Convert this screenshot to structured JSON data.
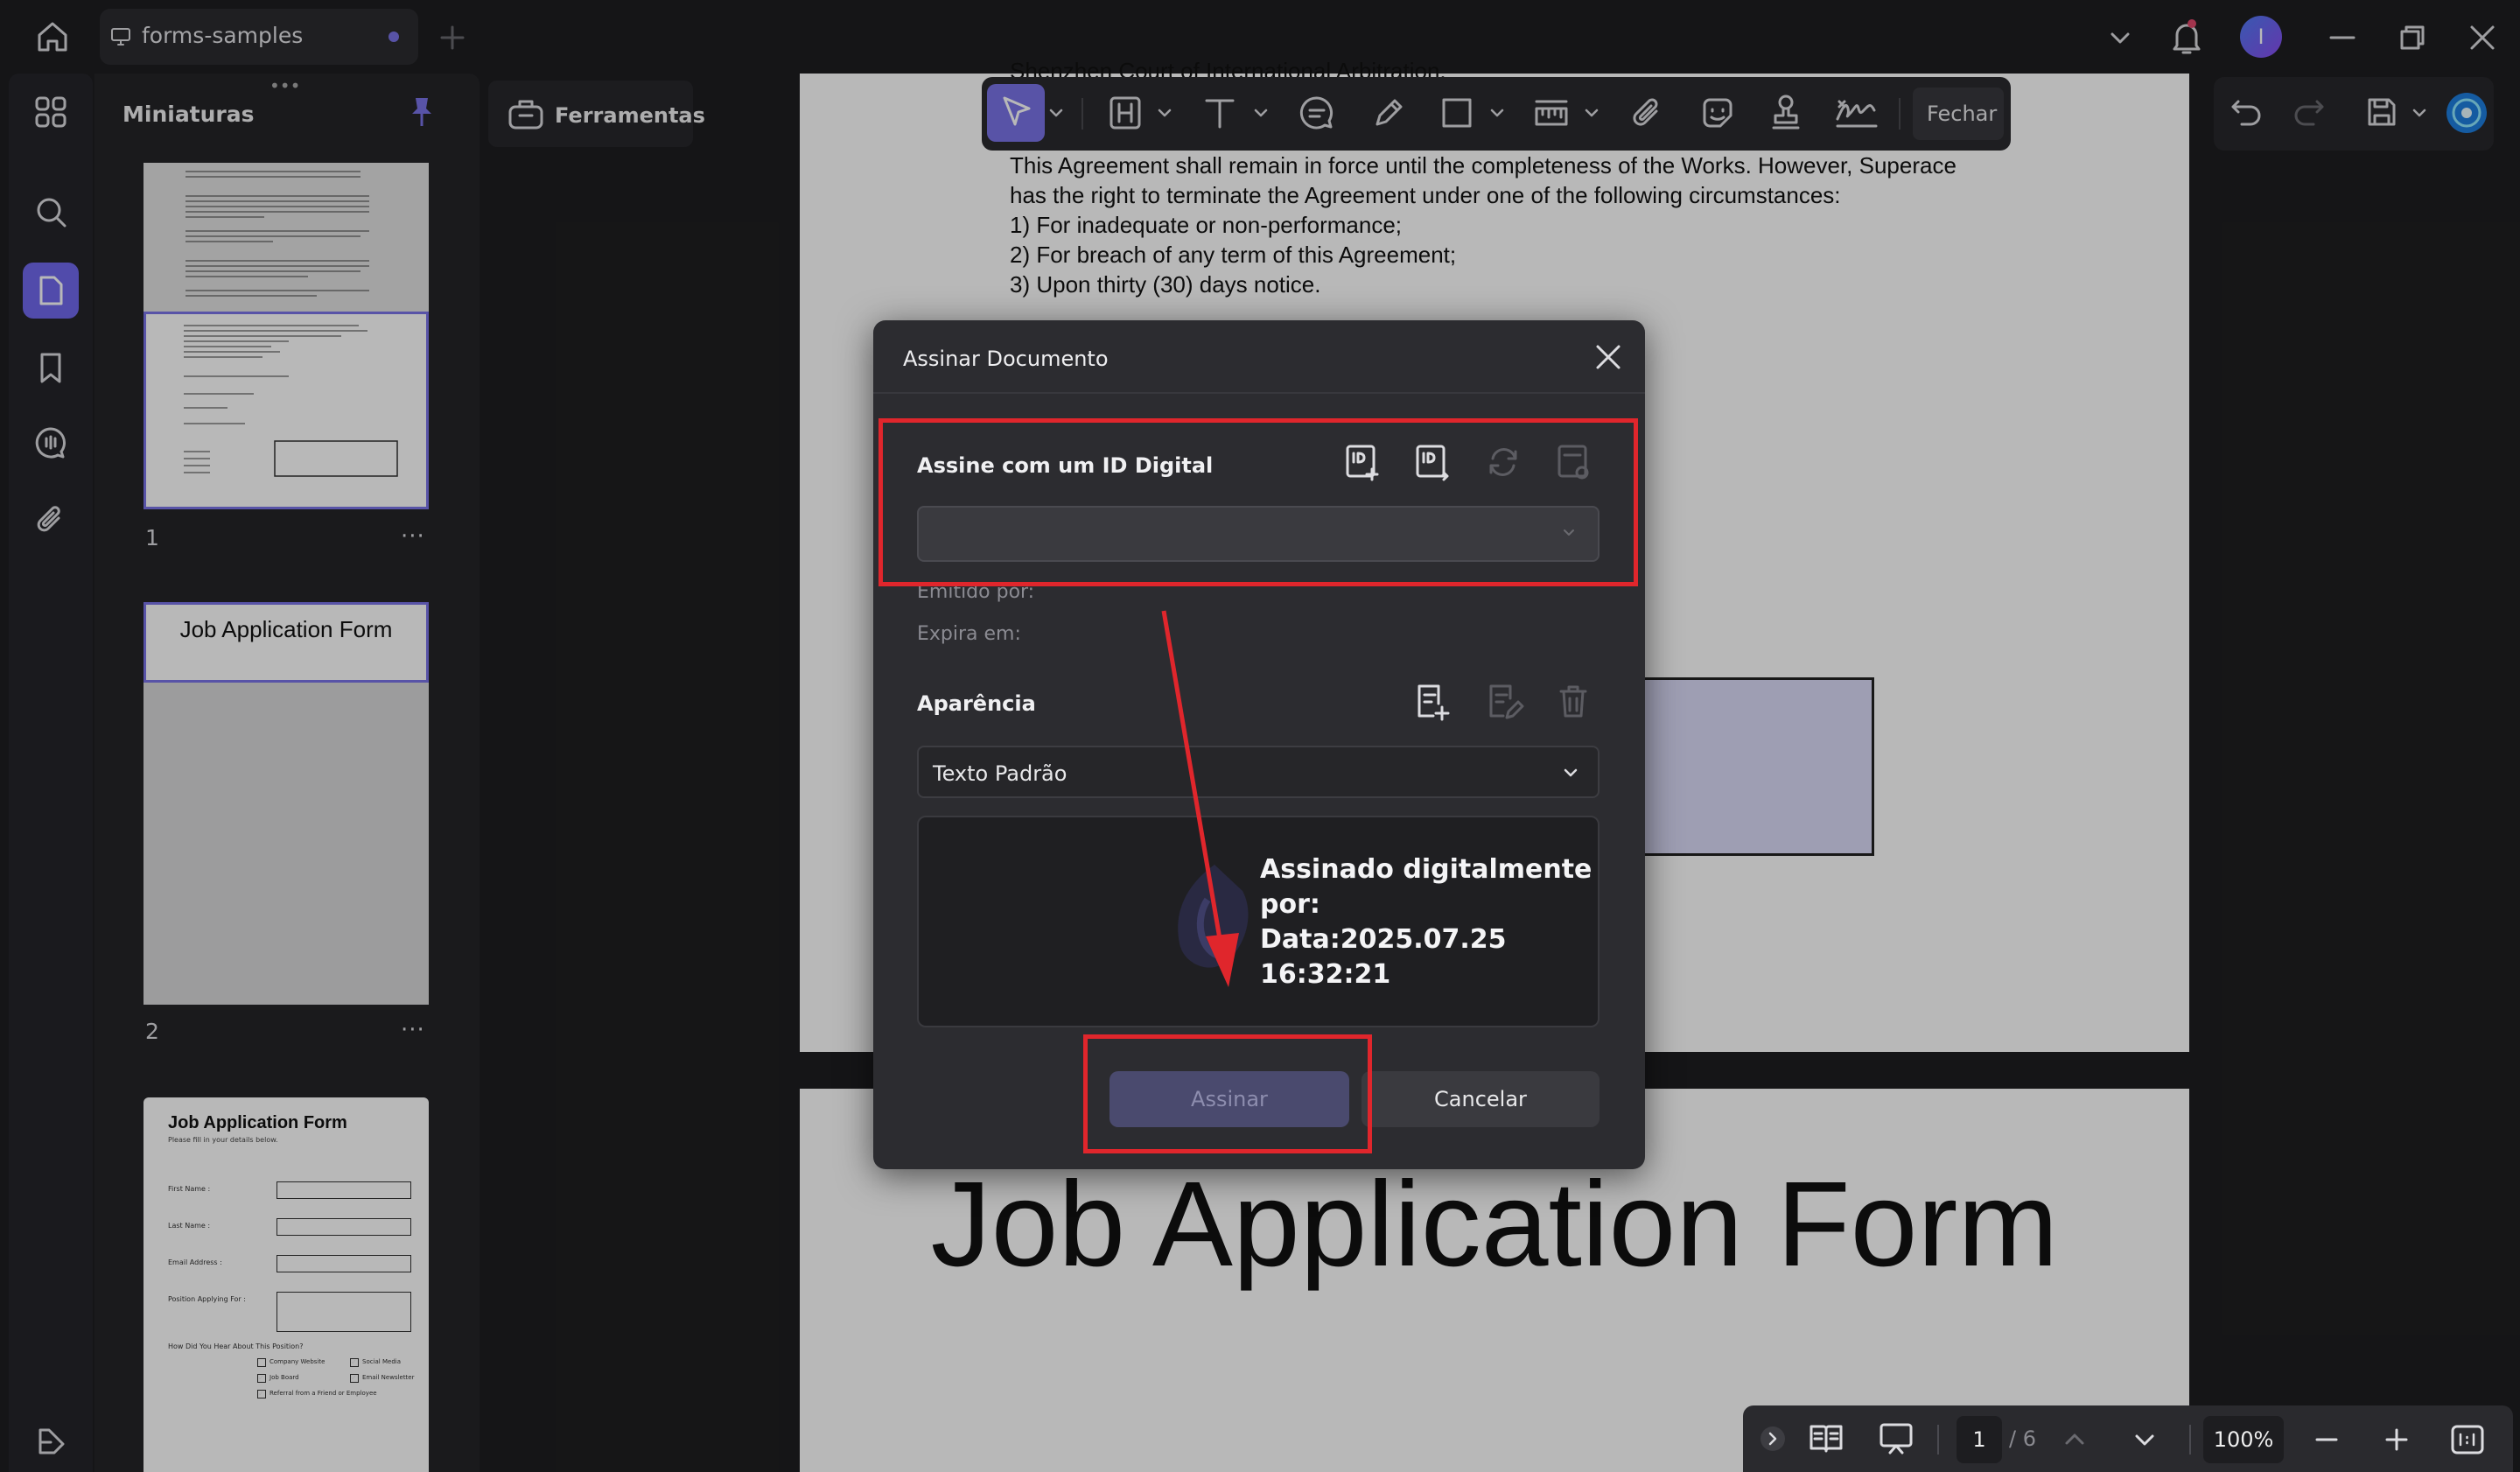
{
  "tab": {
    "label": "forms-samples"
  },
  "user": {
    "initial": "I"
  },
  "thumbnails": {
    "title": "Miniaturas",
    "pages": [
      {
        "number": "1",
        "more": "···"
      },
      {
        "number": "2",
        "more": "···",
        "heading": "Job Application Form"
      },
      {
        "heading": "Job Application Form",
        "subheading": "Please fill in your details below.",
        "fields": [
          "First Name :",
          "Last Name :",
          "Email Address :",
          "Position Applying For :"
        ],
        "question": "How Did You Hear About This Position?",
        "options": [
          "Company Website",
          "Social Media",
          "Job Board",
          "Email Newsletter",
          "Referral from a Friend or Employee"
        ]
      }
    ]
  },
  "tools": {
    "label": "Ferramentas"
  },
  "toolbar": {
    "close_label": "Fechar"
  },
  "document": {
    "cut_line": "Shenzhen Court of International Arbitration.",
    "paragraph": [
      "This Agreement shall remain in force until the completeness of the Works. However, Superace",
      "has the right to terminate the Agreement under one of the following circumstances:",
      "1) For inadequate or non-performance;",
      "2) For breach of any term of this Agreement;",
      "3)  Upon thirty (30) days notice."
    ],
    "page2_title": "Job Application Form"
  },
  "dialog": {
    "title": "Assinar Documento",
    "digital_id_title": "Assine com um ID Digital",
    "issued_by": "Emitido por:",
    "expires": "Expira em:",
    "appearance_title": "Aparência",
    "appearance_value": "Texto Padrão",
    "preview_text": "Assinado digitalmente por:\nData:2025.07.25 16:32:21",
    "sign_label": "Assinar",
    "cancel_label": "Cancelar"
  },
  "bottombar": {
    "page_current": "1",
    "page_total": "/ 6",
    "zoom": "100%"
  }
}
